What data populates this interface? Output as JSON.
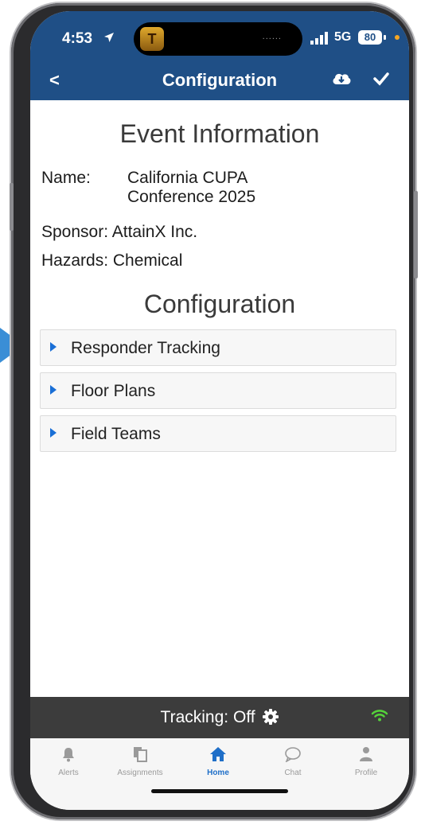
{
  "status": {
    "time": "4:53",
    "island_app_letter": "T",
    "island_dots": "......",
    "network": "5G",
    "battery": "80"
  },
  "nav": {
    "back_icon": "chevron-left-icon",
    "back_glyph": "<",
    "title": "Configuration",
    "cloud_icon": "cloud-download-icon",
    "check_icon": "checkmark-icon"
  },
  "event": {
    "heading": "Event Information",
    "name_label": "Name:",
    "name_line1": "California CUPA",
    "name_line2": "Conference 2025",
    "sponsor_label": "Sponsor:",
    "sponsor_value": "AttainX Inc.",
    "hazards_label": "Hazards:",
    "hazards_value": "Chemical"
  },
  "configuration": {
    "heading": "Configuration",
    "sections": [
      {
        "label": "Responder Tracking"
      },
      {
        "label": "Floor Plans"
      },
      {
        "label": "Field Teams"
      }
    ]
  },
  "tracking": {
    "label": "Tracking:",
    "value": "Off"
  },
  "tabs": [
    {
      "label": "Alerts",
      "icon": "bell-icon"
    },
    {
      "label": "Assignments",
      "icon": "documents-icon"
    },
    {
      "label": "Home",
      "icon": "home-icon",
      "active": true
    },
    {
      "label": "Chat",
      "icon": "chat-bubble-icon"
    },
    {
      "label": "Profile",
      "icon": "person-icon"
    }
  ],
  "colors": {
    "header_blue": "#1f4f86",
    "accent_blue": "#1a6fd6",
    "tracking_bar": "#3c3c3c",
    "wifi_green": "#55d33a"
  }
}
